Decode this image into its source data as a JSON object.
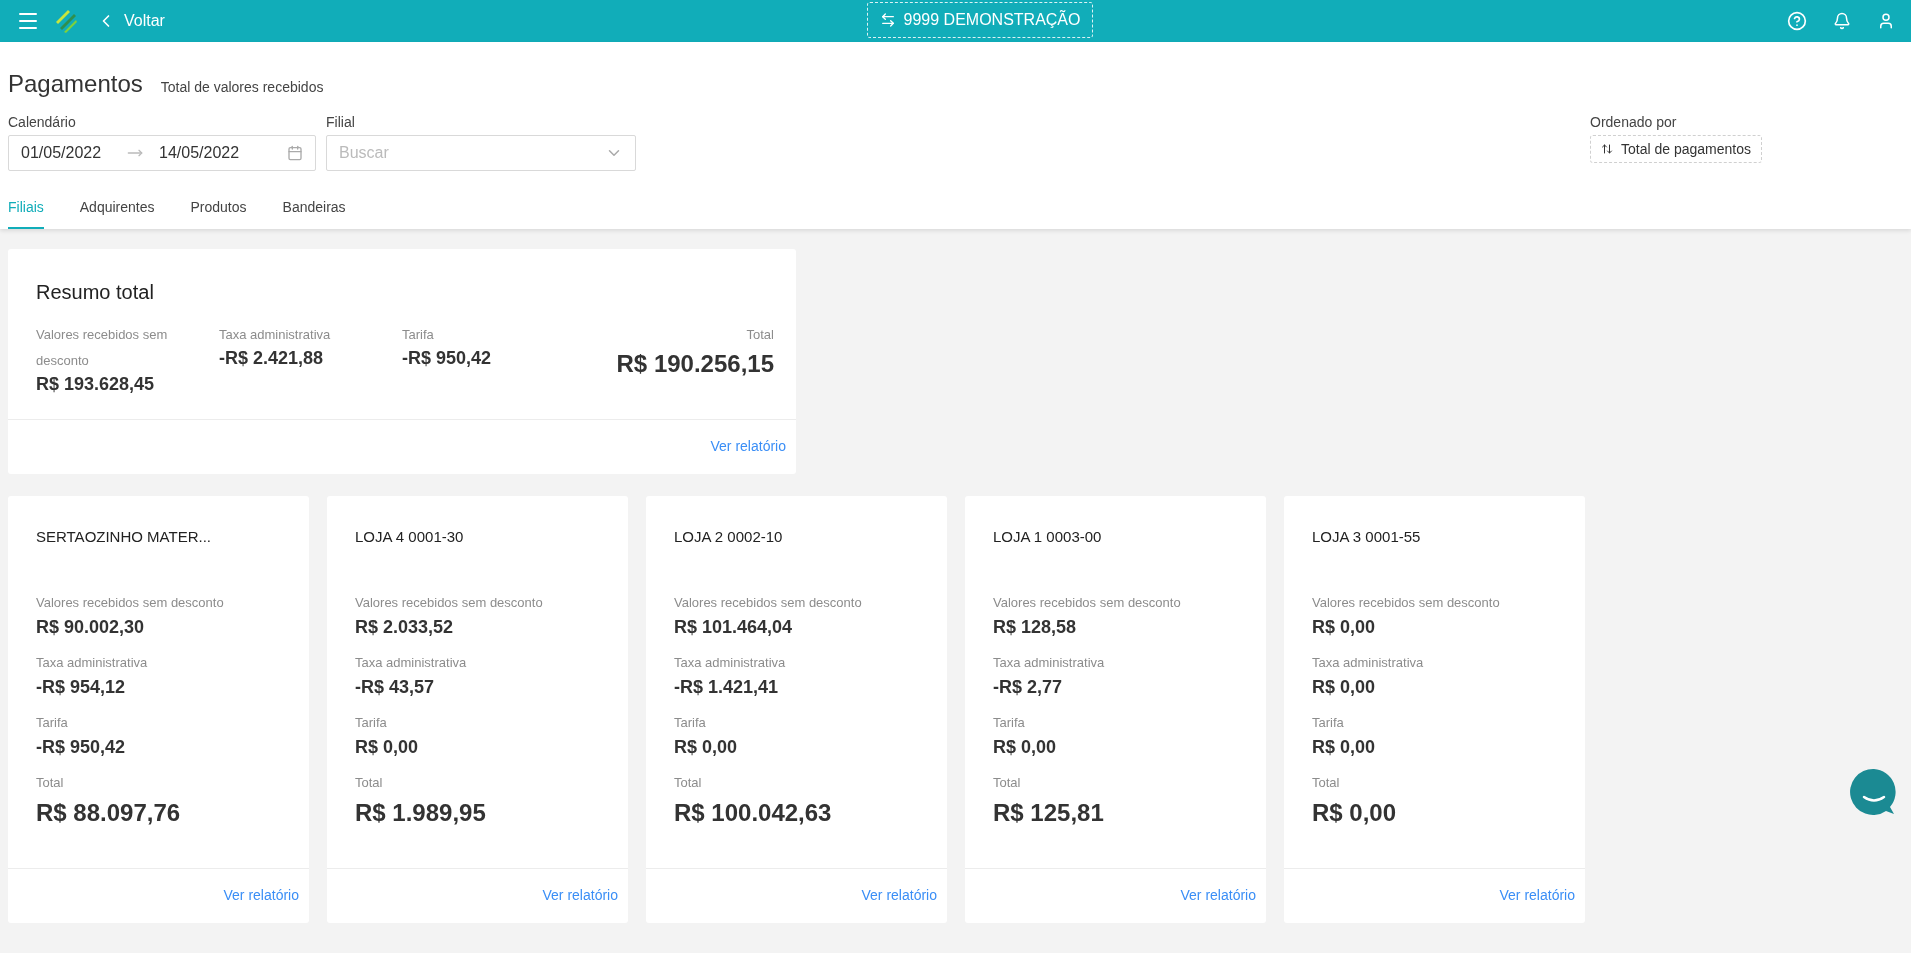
{
  "topbar": {
    "back": "Voltar",
    "company": "9999 DEMONSTRAÇÃO"
  },
  "page": {
    "title": "Pagamentos",
    "subtitle": "Total de valores recebidos"
  },
  "filters": {
    "calendar": {
      "label": "Calendário",
      "start": "01/05/2022",
      "end": "14/05/2022"
    },
    "branch": {
      "label": "Filial",
      "placeholder": "Buscar"
    },
    "sort": {
      "label": "Ordenado por",
      "value": "Total de pagamentos"
    }
  },
  "tabs": [
    {
      "label": "Filiais",
      "selected": true
    },
    {
      "label": "Adquirentes",
      "selected": false
    },
    {
      "label": "Produtos",
      "selected": false
    },
    {
      "label": "Bandeiras",
      "selected": false
    }
  ],
  "summary": {
    "title": "Resumo total",
    "metrics": [
      {
        "label": "Valores recebidos sem desconto",
        "value": "R$ 193.628,45"
      },
      {
        "label": "Taxa administrativa",
        "value": "-R$ 2.421,88"
      },
      {
        "label": "Tarifa",
        "value": "-R$ 950,42"
      }
    ],
    "total": {
      "label": "Total",
      "value": "R$ 190.256,15"
    },
    "link": "Ver relatório"
  },
  "stores": [
    {
      "name": "SERTAOZINHO MATER...",
      "metrics": [
        {
          "label": "Valores recebidos sem desconto",
          "value": "R$ 90.002,30"
        },
        {
          "label": "Taxa administrativa",
          "value": "-R$ 954,12"
        },
        {
          "label": "Tarifa",
          "value": "-R$ 950,42"
        }
      ],
      "total": {
        "label": "Total",
        "value": "R$ 88.097,76"
      },
      "link": "Ver relatório"
    },
    {
      "name": "LOJA 4 0001-30",
      "metrics": [
        {
          "label": "Valores recebidos sem desconto",
          "value": "R$ 2.033,52"
        },
        {
          "label": "Taxa administrativa",
          "value": "-R$ 43,57"
        },
        {
          "label": "Tarifa",
          "value": "R$ 0,00"
        }
      ],
      "total": {
        "label": "Total",
        "value": "R$ 1.989,95"
      },
      "link": "Ver relatório"
    },
    {
      "name": "LOJA 2 0002-10",
      "metrics": [
        {
          "label": "Valores recebidos sem desconto",
          "value": "R$ 101.464,04"
        },
        {
          "label": "Taxa administrativa",
          "value": "-R$ 1.421,41"
        },
        {
          "label": "Tarifa",
          "value": "R$ 0,00"
        }
      ],
      "total": {
        "label": "Total",
        "value": "R$ 100.042,63"
      },
      "link": "Ver relatório"
    },
    {
      "name": "LOJA 1 0003-00",
      "metrics": [
        {
          "label": "Valores recebidos sem desconto",
          "value": "R$ 128,58"
        },
        {
          "label": "Taxa administrativa",
          "value": "-R$ 2,77"
        },
        {
          "label": "Tarifa",
          "value": "R$ 0,00"
        }
      ],
      "total": {
        "label": "Total",
        "value": "R$ 125,81"
      },
      "link": "Ver relatório"
    },
    {
      "name": "LOJA 3 0001-55",
      "metrics": [
        {
          "label": "Valores recebidos sem desconto",
          "value": "R$ 0,00"
        },
        {
          "label": "Taxa administrativa",
          "value": "R$ 0,00"
        },
        {
          "label": "Tarifa",
          "value": "R$ 0,00"
        }
      ],
      "total": {
        "label": "Total",
        "value": "R$ 0,00"
      },
      "link": "Ver relatório"
    }
  ]
}
